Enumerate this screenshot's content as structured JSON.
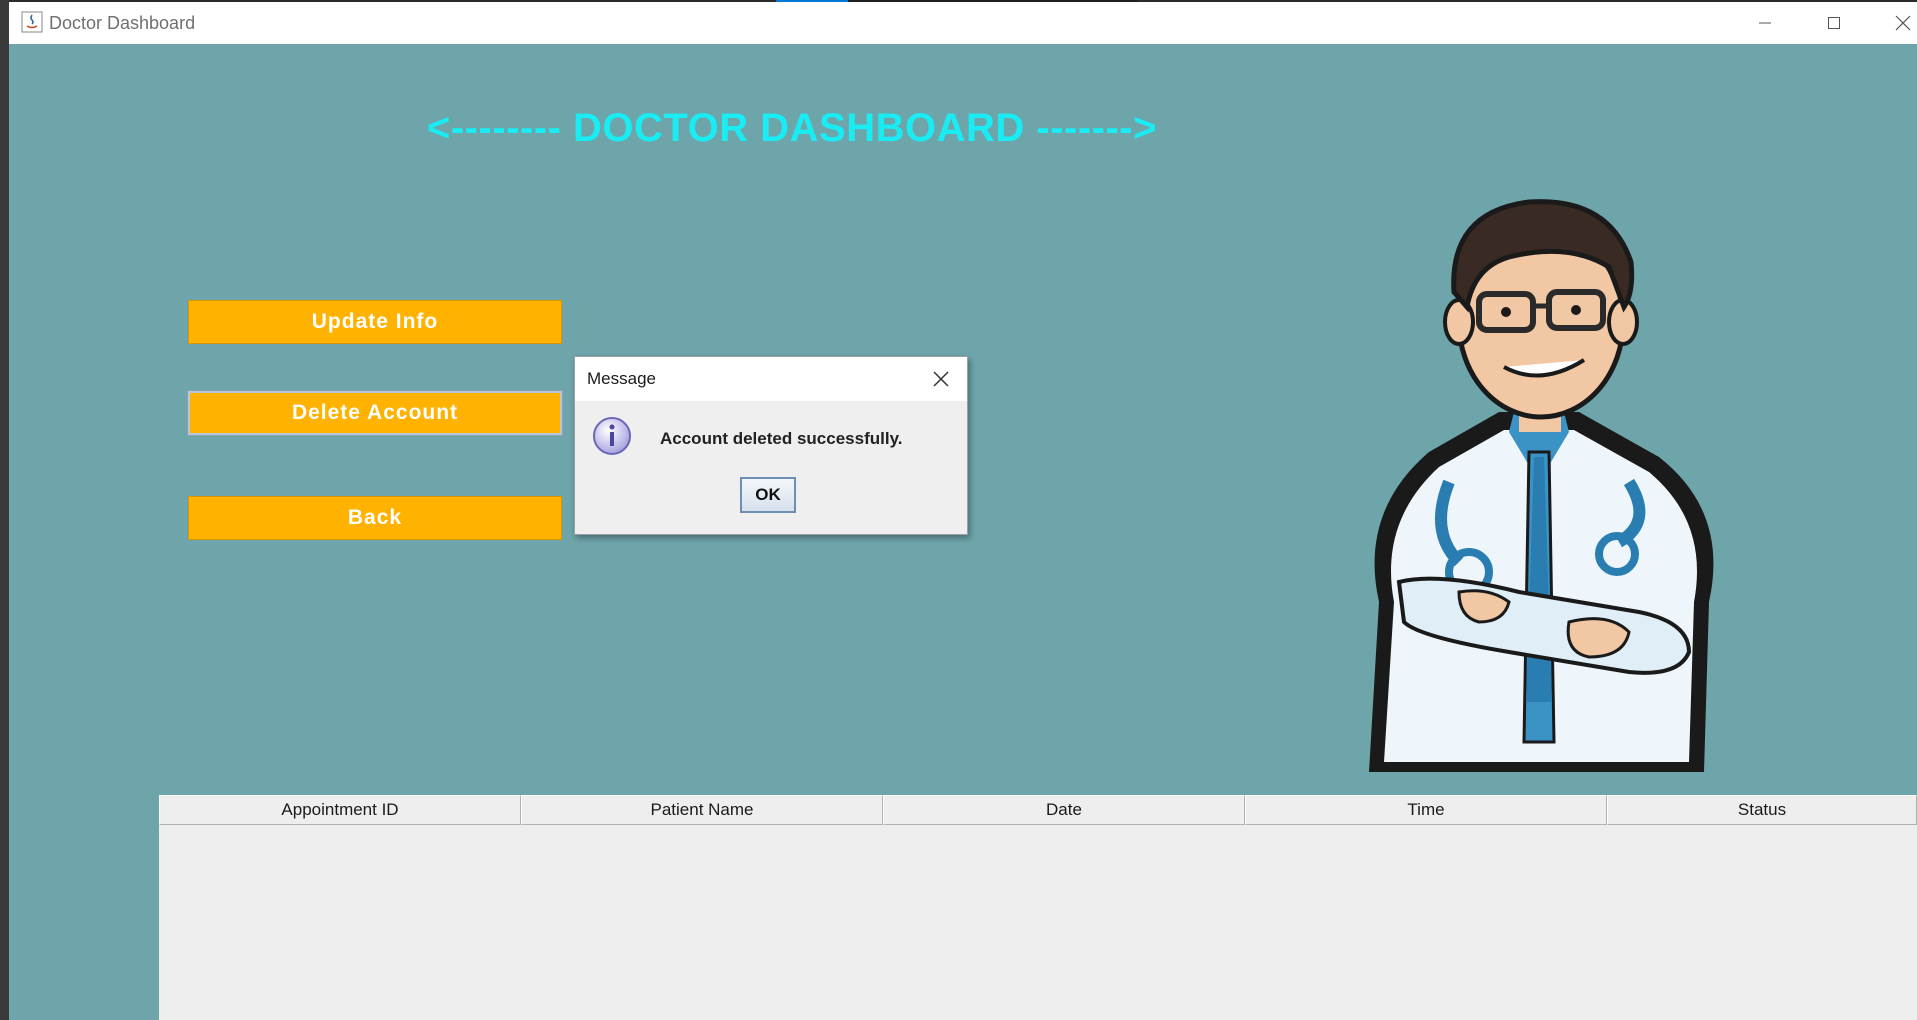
{
  "window": {
    "title": "Doctor Dashboard"
  },
  "heading": "<-------- DOCTOR DASHBOARD ------->",
  "buttons": {
    "update_info": "Update Info",
    "delete_account": "Delete Account",
    "back": "Back"
  },
  "table": {
    "columns": [
      "Appointment ID",
      "Patient Name",
      "Date",
      "Time",
      "Status"
    ],
    "rows": []
  },
  "dialog": {
    "title": "Message",
    "message": "Account deleted successfully.",
    "ok_label": "OK",
    "icon": "info-icon"
  },
  "colors": {
    "background": "#6ea5aa",
    "heading": "#19ecf2",
    "button": "#ffb200"
  }
}
